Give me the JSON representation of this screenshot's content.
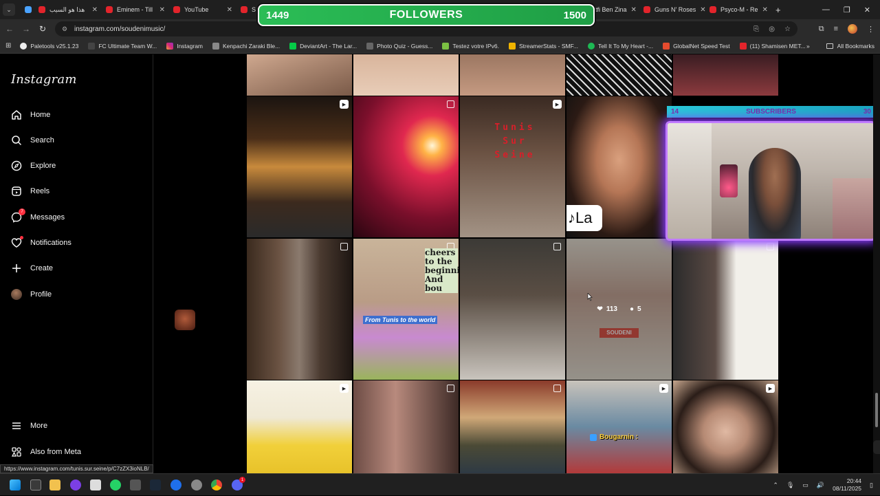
{
  "browser": {
    "tabs": [
      {
        "label": "هذا هو السيب"
      },
      {
        "label": "Eminem - Till"
      },
      {
        "label": "YouTube"
      },
      {
        "label": "S"
      },
      {
        "label": "Lotfi Ben Zina"
      },
      {
        "label": "Guns N' Roses"
      },
      {
        "label": "Psyco-M - Re"
      }
    ],
    "url": "instagram.com/soudenimusic/",
    "bookmarks": [
      "Paletools v25.1.23",
      "FC Ultimate Team W...",
      "Instagram",
      "Kenpachi Zaraki Ble...",
      "DeviantArt - The Lar...",
      "Photo Quiz - Guess...",
      "Testez votre IPv6.",
      "StreamerStats - SMF...",
      "Tell It To My Heart -...",
      "GlobalNet Speed Test",
      "(11) Shamisen MET..."
    ],
    "all_bookmarks": "All Bookmarks",
    "status_url": "https://www.instagram.com/tunis.sur.seine/p/C7zZX3ioNLB/"
  },
  "instagram": {
    "logo": "Instagram",
    "nav": [
      {
        "label": "Home",
        "icon": "home-icon"
      },
      {
        "label": "Search",
        "icon": "search-icon"
      },
      {
        "label": "Explore",
        "icon": "compass-icon"
      },
      {
        "label": "Reels",
        "icon": "reels-icon"
      },
      {
        "label": "Messages",
        "icon": "messenger-icon",
        "badge": "7"
      },
      {
        "label": "Notifications",
        "icon": "heart-icon"
      },
      {
        "label": "Create",
        "icon": "plus-icon"
      },
      {
        "label": "Profile",
        "icon": "avatar"
      }
    ],
    "bottom_nav": [
      {
        "label": "More",
        "icon": "menu-icon"
      },
      {
        "label": "Also from Meta",
        "icon": "meta-icon"
      }
    ],
    "hover_post": {
      "likes": "113",
      "comments": "5"
    },
    "post_texts": {
      "tunis_sur_seine": "Tunis Sur Seine",
      "la": "♪La",
      "cheers": "cheers to the beginni And bou",
      "from_tunis": "From Tunis to the world",
      "soudeni": "SOUDENI"
    }
  },
  "stream_overlay": {
    "followers_current": "1449",
    "followers_label": "FOLLOWERS",
    "followers_goal": "1500",
    "subs_current": "14",
    "subs_label": "SUBSCRIBERS",
    "subs_goal": "30",
    "chat_user": "Bougarnin :"
  },
  "taskbar": {
    "time": "20:44",
    "date": "08/11/2025",
    "discord_badge": "1"
  }
}
